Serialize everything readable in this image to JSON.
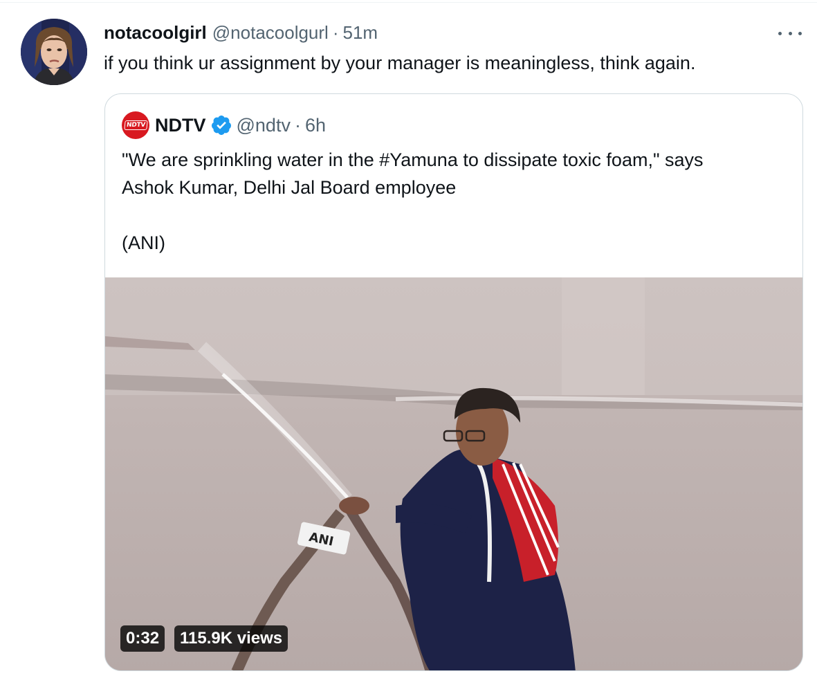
{
  "tweet": {
    "display_name": "notacoolgirl",
    "handle": "@notacoolgurl",
    "separator": "·",
    "time": "51m",
    "text": "if you think ur assignment by your manager is meaningless, think again.",
    "avatar_icon": "user-avatar"
  },
  "quote": {
    "logo_text": "NDTV",
    "display_name": "NDTV",
    "handle": "@ndtv",
    "separator": "·",
    "time": "6h",
    "text_line1": "\"We are sprinkling water in the #Yamuna to dissipate toxic foam,\" says",
    "text_line2": "Ashok Kumar, Delhi Jal Board employee",
    "text_line3": "(ANI)",
    "media": {
      "duration": "0:32",
      "views": "115.9K views",
      "mic_logo_text": "ANI"
    }
  },
  "colors": {
    "text_primary": "#0f1419",
    "text_secondary": "#536471",
    "border": "#cfd9de",
    "verified_blue": "#1d9bf0",
    "ndtv_red": "#d81920"
  }
}
